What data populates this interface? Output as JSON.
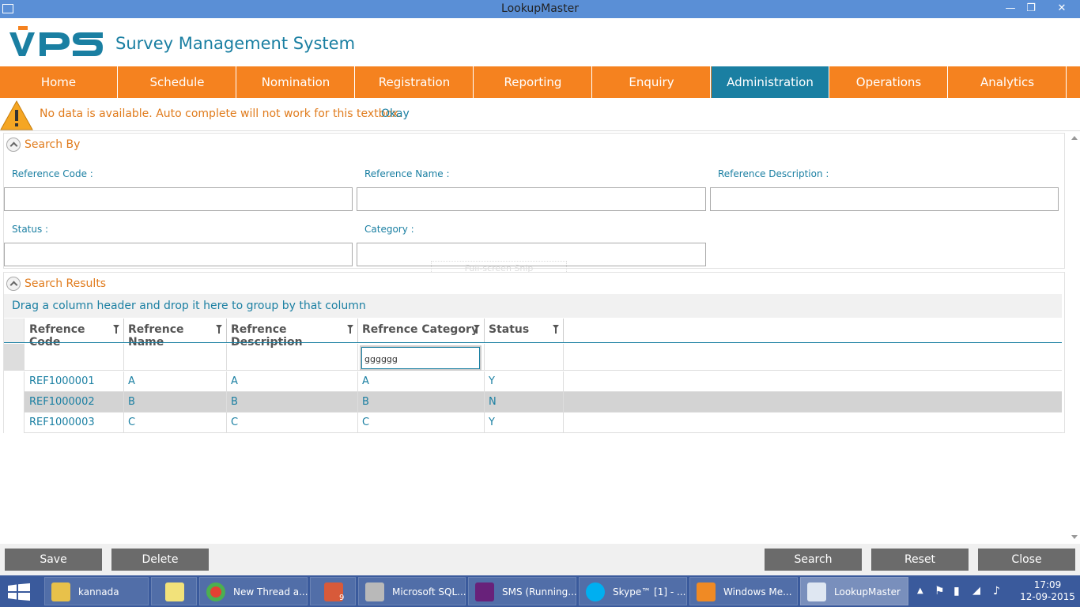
{
  "window": {
    "title": "LookupMaster"
  },
  "header": {
    "app_name": "Survey Management System"
  },
  "nav": {
    "items": [
      "Home",
      "Schedule",
      "Nomination",
      "Registration",
      "Reporting",
      "Enquiry",
      "Administration",
      "Operations",
      "Analytics"
    ],
    "active": "Administration"
  },
  "alert": {
    "message": "No data is available. Auto complete will not work for this textbox.",
    "action": "Okay"
  },
  "search_by": {
    "title": "Search By",
    "fields": {
      "reference_code": {
        "label": "Reference Code :",
        "value": ""
      },
      "reference_name": {
        "label": "Reference Name :",
        "value": ""
      },
      "reference_description": {
        "label": "Reference Description :",
        "value": ""
      },
      "status": {
        "label": "Status :",
        "value": ""
      },
      "category": {
        "label": "Category :",
        "value": ""
      }
    }
  },
  "overlay": {
    "snip_text": "Full-screen Snip"
  },
  "results": {
    "title": "Search Results",
    "group_hint": "Drag a column header and drop it here to group by that column",
    "columns": [
      "Refrence Code",
      "Refrence Name",
      "Refrence Description",
      "Refrence Category",
      "Status"
    ],
    "filter_value": "gggggg",
    "rows": [
      [
        "REF1000001",
        "A",
        "A",
        "A",
        "Y"
      ],
      [
        "REF1000002",
        "B",
        "B",
        "B",
        "N"
      ],
      [
        "REF1000003",
        "C",
        "C",
        "C",
        "Y"
      ]
    ],
    "selected_row": 1
  },
  "footer": {
    "save": "Save",
    "delete": "Delete",
    "search": "Search",
    "reset": "Reset",
    "close": "Close"
  },
  "taskbar": {
    "items": [
      {
        "label": "kannada",
        "icon": "folder-icon"
      },
      {
        "label": "",
        "icon": "sticky-notes-icon"
      },
      {
        "label": "New Thread a...",
        "icon": "chrome-icon"
      },
      {
        "label": "",
        "icon": "tools-icon",
        "badge": "9"
      },
      {
        "label": "Microsoft SQL...",
        "icon": "sql-server-icon"
      },
      {
        "label": "SMS (Running...",
        "icon": "visual-studio-icon"
      },
      {
        "label": "Skype™ [1] - ...",
        "icon": "skype-icon"
      },
      {
        "label": "Windows Me...",
        "icon": "media-player-icon"
      },
      {
        "label": "LookupMaster",
        "icon": "app-icon"
      }
    ],
    "time": "17:09",
    "date": "12-09-2015"
  },
  "colors": {
    "orange": "#f5821f",
    "teal": "#1a7fa2",
    "titlebar": "#5a8fd6",
    "taskbar": "#3a5a9c"
  }
}
